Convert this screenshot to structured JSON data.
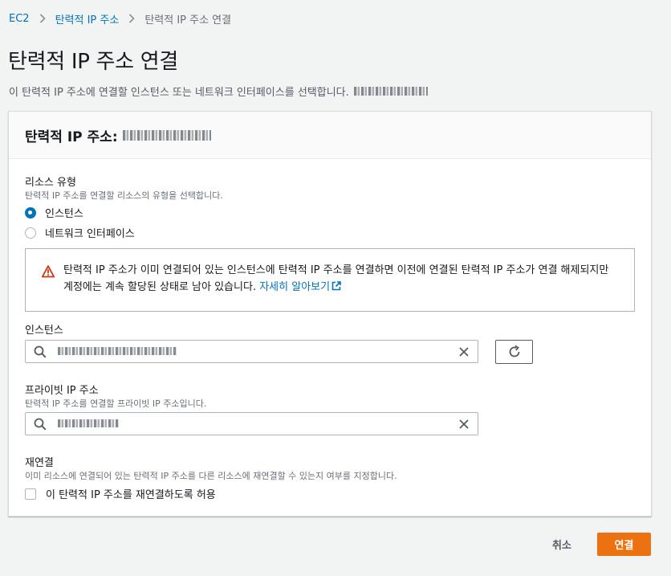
{
  "breadcrumb": {
    "items": [
      "EC2",
      "탄력적 IP 주소",
      "탄력적 IP 주소 연결"
    ]
  },
  "page": {
    "title": "탄력적 IP 주소 연결",
    "description": "이 탄력적 IP 주소에 연결할 인스턴스 또는 네트워크 인터페이스를 선택합니다."
  },
  "panel": {
    "header_label": "탄력적 IP 주소:"
  },
  "resource_type": {
    "label": "리소스 유형",
    "help": "탄력적 IP 주소를 연결할 리소스의 유형을 선택합니다.",
    "options": [
      "인스턴스",
      "네트워크 인터페이스"
    ],
    "selected": "인스턴스"
  },
  "alert": {
    "text": "탄력적 IP 주소가 이미 연결되어 있는 인스턴스에 탄력적 IP 주소를 연결하면 이전에 연결된 탄력적 IP 주소가 연결 해제되지만 계정에는 계속 할당된 상태로 남아 있습니다.",
    "link": "자세히 알아보기"
  },
  "instance": {
    "label": "인스턴스"
  },
  "private_ip": {
    "label": "프라이빗 IP 주소",
    "help": "탄력적 IP 주소를 연결할 프라이빗 IP 주소입니다."
  },
  "reassociation": {
    "label": "재연결",
    "help": "이미 리소스에 연결되어 있는 탄력적 IP 주소를 다른 리소스에 재연결할 수 있는지 여부를 지정합니다.",
    "checkbox_label": "이 탄력적 IP 주소를 재연결하도록 허용",
    "checked": false
  },
  "actions": {
    "cancel": "취소",
    "submit": "연결"
  },
  "colors": {
    "primary": "#ec7211",
    "link": "#0073bb",
    "warning": "#d13212"
  },
  "icons": [
    "chevron-right-icon",
    "warning-icon",
    "external-link-icon",
    "search-icon",
    "clear-icon",
    "refresh-icon"
  ]
}
